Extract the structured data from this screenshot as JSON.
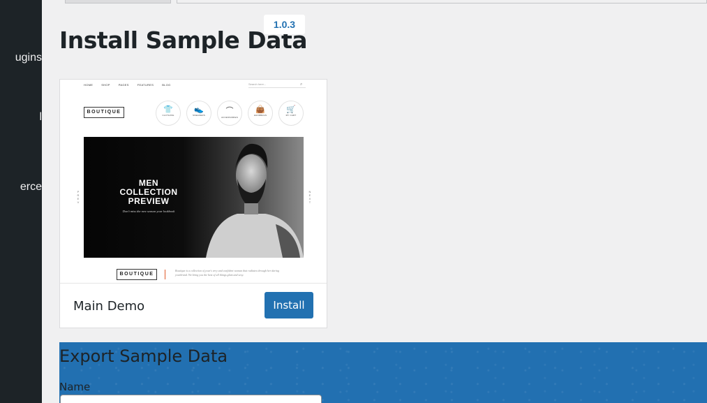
{
  "sidebar": {
    "items": [
      {
        "label": "Plugins",
        "visible": "ugins"
      },
      {
        "label": "Install",
        "visible": "l"
      },
      {
        "label": "WooCommerce",
        "visible": "erce"
      }
    ]
  },
  "header": {
    "title": "Install Sample Data",
    "version": "1.0.3"
  },
  "demo": {
    "name": "Main Demo",
    "install_label": "Install",
    "preview": {
      "nav": [
        "HOME",
        "SHOP",
        "PAGES",
        "FEATURES",
        "BLOG"
      ],
      "search_placeholder": "Search here...",
      "logo": "BOUTIQUE",
      "categories": [
        {
          "label": "CLOTHING",
          "glyph": "👕"
        },
        {
          "label": "SNEAKERS",
          "glyph": "👟"
        },
        {
          "label": "ACCESSORIES",
          "glyph": "⌒"
        },
        {
          "label": "HANDBAGS",
          "glyph": "👜"
        },
        {
          "label": "MY CART",
          "glyph": "🛒"
        }
      ],
      "hero_title": "MEN COLLECTION PREVIEW",
      "hero_subtitle": "Don't miss the new season your lookbook",
      "prev": "P R E V",
      "next": "N E X T",
      "footer_logo": "BOUTIQUE",
      "footer_text": "Boutique is a collection of your's very and confident woman that radiates through her daring yourbrand. We bring you the best of all things glam and sexy."
    }
  },
  "export": {
    "title": "Export Sample Data",
    "name_label": "Name",
    "name_value": ""
  },
  "colors": {
    "accent": "#2271b1",
    "sidebar": "#1d2327",
    "background": "#f0f0f1"
  }
}
